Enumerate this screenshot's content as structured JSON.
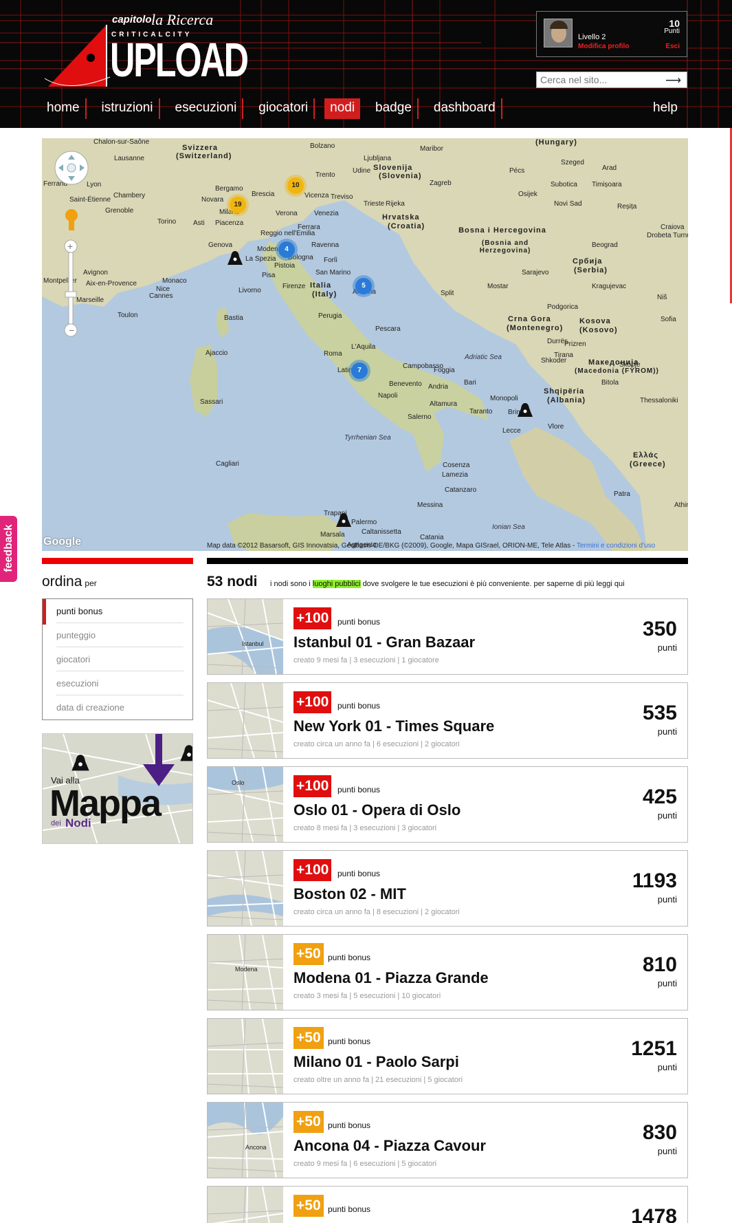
{
  "logo": {
    "line1": "capitolo",
    "line1b": "la Ricerca",
    "line2": "CRITICALCITY",
    "line3": "UPLOAD"
  },
  "user": {
    "level": "Livello 2",
    "edit_profile": "Modifica profilo",
    "points": "10",
    "points_label": "Punti",
    "logout": "Esci"
  },
  "search": {
    "placeholder": "Cerca nel sito..."
  },
  "nav": {
    "items": [
      "home",
      "istruzioni",
      "esecuzioni",
      "giocatori",
      "nodi",
      "badge",
      "dashboard"
    ],
    "help": "help",
    "active": "nodi"
  },
  "map": {
    "copyright": "Map data ©2012 Basarsoft, GIS Innovatsia, GeoBasis-DE/BKG (©2009), Google, Mapa GISrael, ORION-ME, Tele Atlas -",
    "terms": "Termini e condizioni d'uso",
    "google": "Google",
    "clusters": [
      "19",
      "10",
      "4",
      "5",
      "7"
    ],
    "cities": [
      "Chalon-sur-Saône",
      "Lausanne",
      "Ferrand",
      "Lyon",
      "Chambery",
      "Saint-Étienne",
      "Grenoble",
      "Torino",
      "Asti",
      "Genova",
      "La Spezia",
      "Bergamo",
      "Brescia",
      "Milano",
      "Piacenza",
      "Novara",
      "Verona",
      "Vicenza",
      "Venezia",
      "Treviso",
      "Trento",
      "Bolzano",
      "Reggio nell'Emilia",
      "Modena",
      "Bologna",
      "Ravenna",
      "Ferrara",
      "Forlì",
      "Pistoia",
      "Pisa",
      "Firenze",
      "Livorno",
      "Perugia",
      "San Marino",
      "Ancona",
      "Pescara",
      "L'Aquila",
      "Roma",
      "Latina",
      "Napoli",
      "Foggia",
      "Campobasso",
      "Benevento",
      "Andria",
      "Bari",
      "Altamura",
      "Taranto",
      "Brindisi",
      "Lecce",
      "Monopoli",
      "Salerno",
      "Cosenza",
      "Lamezia",
      "Catanzaro",
      "Messina",
      "Palermo",
      "Trapani",
      "Marsala",
      "Catania",
      "Caltanissetta",
      "Agrigento",
      "Sassari",
      "Cagliari",
      "Ajaccio",
      "Bastia",
      "Monaco",
      "Nice",
      "Cannes",
      "Toulon",
      "Marseille",
      "Aix-en-Provence",
      "Montpellier",
      "Avignon",
      "Udine",
      "Trieste",
      "Ljubljana",
      "Zagreb",
      "Maribor",
      "Rijeka",
      "Split",
      "Sarajevo",
      "Mostar",
      "Podgorica",
      "Tirana",
      "Durrës",
      "Skopje",
      "Sofia",
      "Niš",
      "Beograd",
      "Novi Sad",
      "Osijek",
      "Pécs",
      "Szeged",
      "Arad",
      "Timișoara",
      "Subotica",
      "Reșița",
      "Craiova",
      "Drobeta Turnu Severin",
      "Kragujevac",
      "Prizren",
      "Shkoder",
      "Bitola",
      "Vlore",
      "Thessaloniki",
      "Patra",
      "Athina"
    ],
    "countries": [
      "(Hungary)",
      "Svizzera",
      "(Switzerland)",
      "Slovenija",
      "(Slovenia)",
      "Hrvatska",
      "(Croatia)",
      "Bosna i Hercegovina",
      "(Bosnia and Herzegovina)",
      "Србија",
      "(Serbia)",
      "Italia",
      "(Italy)",
      "Crna Gora",
      "(Montenegro)",
      "Kosova",
      "(Kosovo)",
      "Македонија",
      "(Macedonia (FYROM))",
      "Shqipëria",
      "(Albania)",
      "Ελλάς",
      "(Greece)"
    ],
    "seas": [
      "Adriatic Sea",
      "Tyrrhenian Sea",
      "Ionian Sea"
    ]
  },
  "sort": {
    "title": "ordina",
    "subtitle": "per",
    "options": [
      "punti bonus",
      "punteggio",
      "giocatori",
      "esecuzioni",
      "data di creazione"
    ]
  },
  "promo": {
    "line1": "Vai alla",
    "line2": "Mappa",
    "line3a": "dei",
    "line3b": "Nodi"
  },
  "list": {
    "count": "53 nodi",
    "intro_pre": "i nodi sono i",
    "intro_hl": "luoghi pubblici",
    "intro_post": "dove svolgere le tue esecuzioni è più conveniente. per saperne di più leggi qui",
    "bonus_label": "punti bonus",
    "points_label": "punti",
    "items": [
      {
        "bonus": "+100",
        "title": "Istanbul 01 - Gran Bazaar",
        "meta": "creato 9 mesi fa | 3 esecuzioni | 1 giocatore",
        "points": "350"
      },
      {
        "bonus": "+100",
        "title": "New York 01 - Times Square",
        "meta": "creato circa un anno fa | 6 esecuzioni | 2 giocatori",
        "points": "535"
      },
      {
        "bonus": "+100",
        "title": "Oslo 01 - Opera di Oslo",
        "meta": "creato 8 mesi fa | 3 esecuzioni | 3 giocatori",
        "points": "425"
      },
      {
        "bonus": "+100",
        "title": "Boston 02 - MIT",
        "meta": "creato circa un anno fa | 8 esecuzioni | 2 giocatori",
        "points": "1193"
      },
      {
        "bonus": "+50",
        "title": "Modena 01 - Piazza Grande",
        "meta": "creato 3 mesi fa | 5 esecuzioni | 10 giocatori",
        "points": "810"
      },
      {
        "bonus": "+50",
        "title": "Milano 01 - Paolo Sarpi",
        "meta": "creato oltre un anno fa | 21 esecuzioni | 5 giocatori",
        "points": "1251"
      },
      {
        "bonus": "+50",
        "title": "Ancona 04 - Piazza Cavour",
        "meta": "creato 9 mesi fa | 6 esecuzioni | 5 giocatori",
        "points": "830"
      },
      {
        "bonus": "+50",
        "title": "",
        "meta": "",
        "points": "1478"
      }
    ],
    "thumb_labels": [
      "Istanbul",
      "Oslo",
      "Modena",
      "Ancona"
    ]
  },
  "feedback": "feedback",
  "colors": {
    "accent_red": "#e00e0e",
    "bonus_orange": "#f0a010",
    "feedback_pink": "#e0247a",
    "highlight_green": "#8ef02a",
    "nav_active": "#d01e1e"
  }
}
